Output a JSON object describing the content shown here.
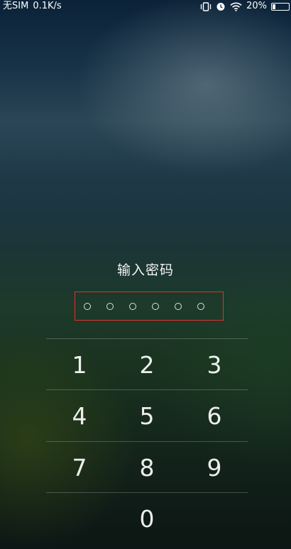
{
  "status_bar": {
    "carrier": "无SIM",
    "network_speed": "0.1K/s",
    "battery_percent": "20%",
    "battery_level": 0.2,
    "icons": [
      "vibrate-icon",
      "alarm-icon",
      "wifi-icon",
      "battery-icon"
    ]
  },
  "lock_screen": {
    "title": "输入密码",
    "pin_length": 6,
    "keys": [
      "1",
      "2",
      "3",
      "4",
      "5",
      "6",
      "7",
      "8",
      "9",
      "0"
    ]
  },
  "colors": {
    "highlight_box": "#e0302e",
    "text": "#ffffff"
  }
}
